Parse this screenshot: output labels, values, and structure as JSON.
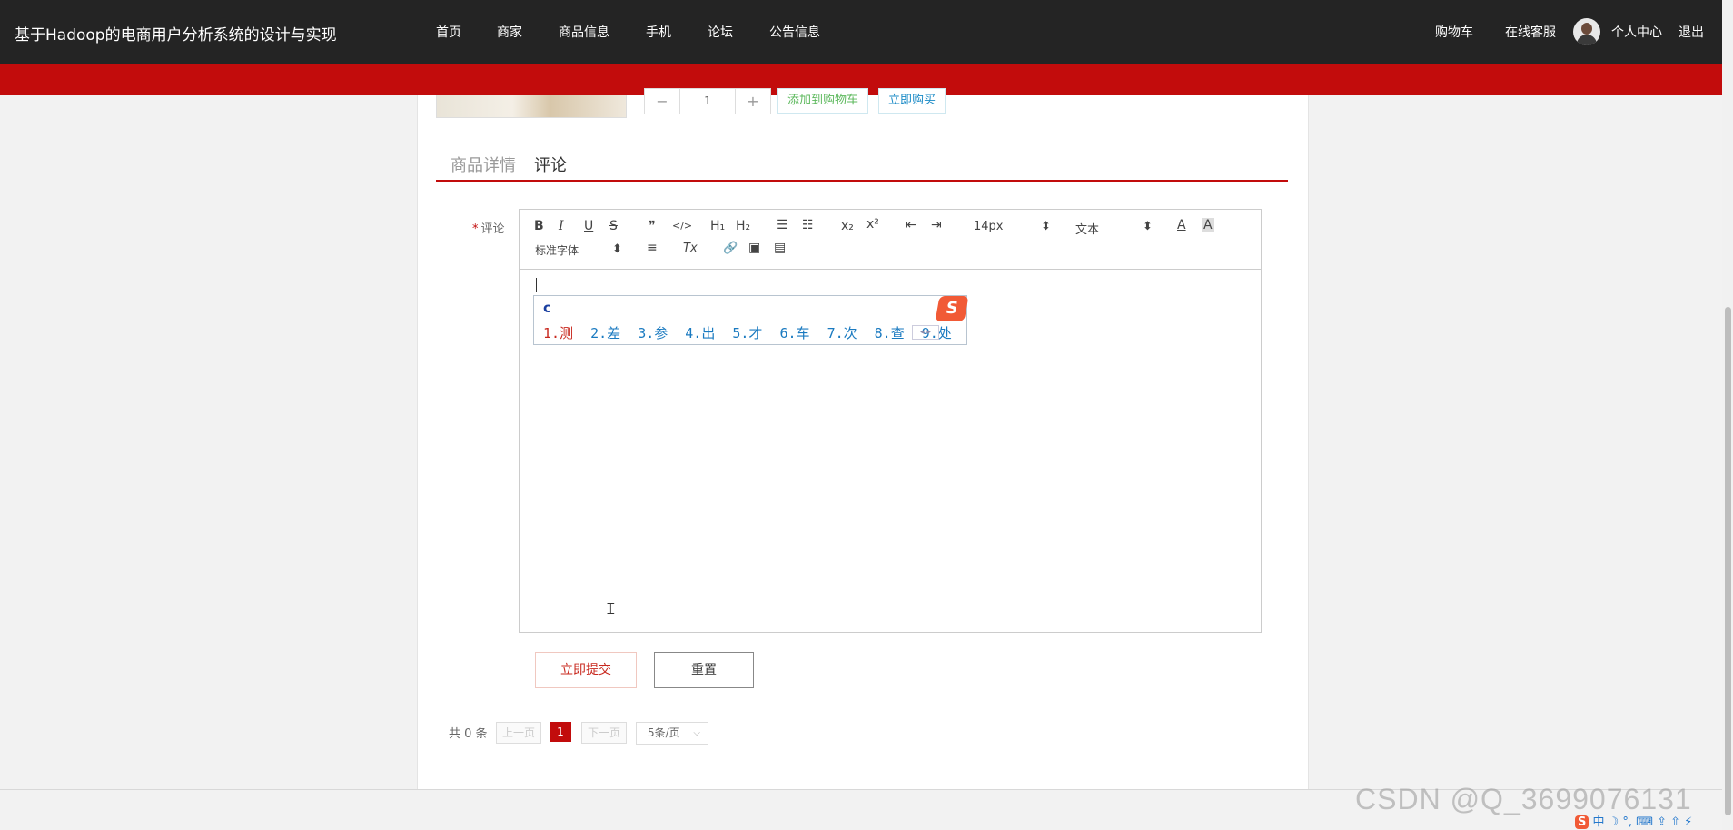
{
  "header": {
    "site_title": "基于Hadoop的电商用户分析系统的设计与实现",
    "nav": [
      "首页",
      "商家",
      "商品信息",
      "手机",
      "论坛",
      "公告信息"
    ],
    "right_links": {
      "cart": "购物车",
      "service": "在线客服",
      "profile": "个人中心",
      "logout": "退出"
    }
  },
  "product": {
    "quantity": "1",
    "minus": "−",
    "plus": "+",
    "add_to_cart": "添加到购物车",
    "buy_now": "立即购买"
  },
  "tabs": {
    "details": "商品详情",
    "comments": "评论",
    "active": "评论"
  },
  "form": {
    "required_mark": "*",
    "comment_label": "评论",
    "toolbar": {
      "bold": "B",
      "italic": "I",
      "underline": "U",
      "strike": "S",
      "quote": "❞",
      "code": "</>",
      "h1": "H₁",
      "h2": "H₂",
      "ordered_list": "☰",
      "bullet_list": "☷",
      "subscript": "x₂",
      "superscript": "x²",
      "outdent": "⇤",
      "indent": "⇥",
      "font_size": "14px",
      "header_select": "文本",
      "font_color": "A",
      "background_color": "A",
      "font_family": "标准字体",
      "align": "≡",
      "clean": "Tx",
      "link": "🔗",
      "image": "▣",
      "video": "▤"
    },
    "submit": "立即提交",
    "reset": "重置"
  },
  "ime": {
    "typed": "c",
    "candidates": [
      "1.测",
      "2.差",
      "3.参",
      "4.出",
      "5.才",
      "6.车",
      "7.次",
      "8.查",
      "9.处"
    ],
    "logo": "S",
    "pager": "◂ ▸"
  },
  "pagination": {
    "total": "共 0 条",
    "prev": "上一页",
    "current": "1",
    "next": "下一页",
    "page_size": "5条/页"
  },
  "watermark": "CSDN @Q_3699076131",
  "tray": {
    "logo": "S",
    "text": "中 ☽ °, ⌨ ⇪ ⇧ ⚡"
  }
}
